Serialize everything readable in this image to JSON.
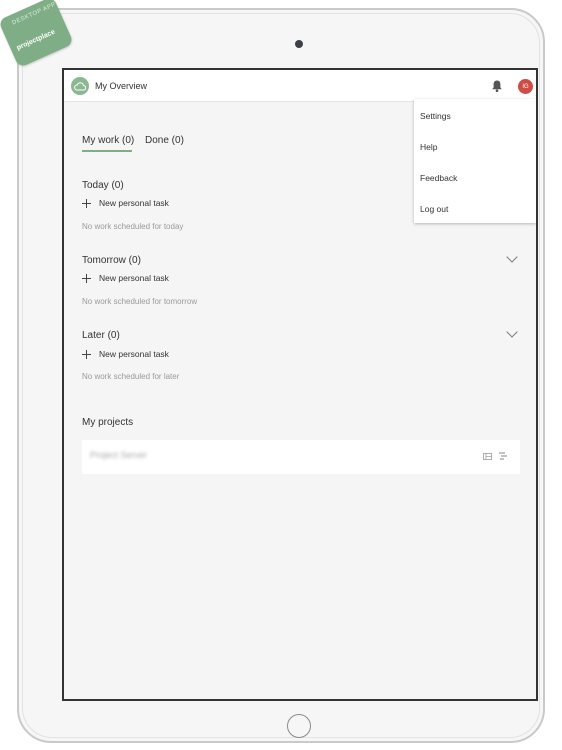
{
  "badge": {
    "logo_text": "DESKTOP APP",
    "label": "projectplace"
  },
  "topbar": {
    "title": "My Overview",
    "avatar_initials": "IG"
  },
  "tabs": [
    {
      "label": "My work (0)",
      "active": true
    },
    {
      "label": "Done (0)",
      "active": false
    }
  ],
  "sections": [
    {
      "title": "Today (0)",
      "add_label": "New personal task",
      "empty_text": "No work scheduled for today"
    },
    {
      "title": "Tomorrow (0)",
      "add_label": "New personal task",
      "empty_text": "No work scheduled for tomorrow"
    },
    {
      "title": "Later (0)",
      "add_label": "New personal task",
      "empty_text": "No work scheduled for later"
    }
  ],
  "projects": {
    "title": "My projects",
    "items": [
      {
        "name": "Project Server"
      }
    ]
  },
  "menu": {
    "items": [
      "Settings",
      "Help",
      "Feedback",
      "Log out"
    ]
  },
  "colors": {
    "accent": "#7fae86",
    "avatar": "#cf4b43"
  },
  "icons": [
    "bell-icon",
    "chevron-down-icon",
    "plus-icon",
    "calendar-icon",
    "list-icon",
    "cloud-icon"
  ]
}
